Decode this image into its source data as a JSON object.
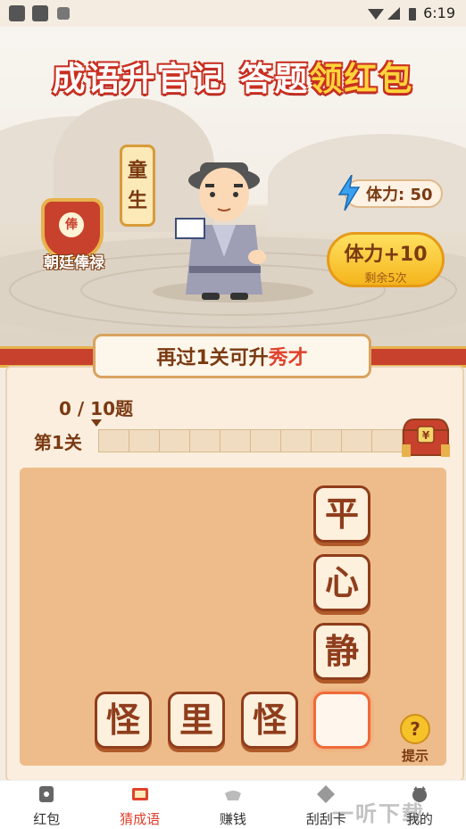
{
  "status_bar": {
    "time": "6:19"
  },
  "header": {
    "title_main": "成语升官记 答题",
    "title_highlight": "领红包"
  },
  "profile": {
    "rank": "童生",
    "salary_label": "朝廷俸禄",
    "salary_coin": "俸",
    "stamina_label": "体力: 50",
    "stamina_button": "体力+10",
    "stamina_remaining": "剩余5次"
  },
  "promotion": {
    "prefix": "再过1关可升",
    "rank_next": "秀才"
  },
  "progress": {
    "count": "0 / 10题",
    "level": "第1关",
    "segments": 10,
    "completed": 0
  },
  "board": {
    "column_tiles": [
      "平",
      "心",
      "静"
    ],
    "answer_tiles": [
      "怪",
      "里",
      "怪",
      ""
    ],
    "hint_label": "提示"
  },
  "tabs": [
    {
      "label": "红包",
      "icon": "wallet-icon",
      "active": false
    },
    {
      "label": "猜成语",
      "icon": "scroll-icon",
      "active": true
    },
    {
      "label": "赚钱",
      "icon": "ingot-icon",
      "active": false
    },
    {
      "label": "刮刮卡",
      "icon": "scratch-card-icon",
      "active": false
    },
    {
      "label": "我的",
      "icon": "profile-icon",
      "active": false
    }
  ],
  "watermark": "一听下载",
  "colors": {
    "accent": "#e0412d",
    "brown": "#7a3a12",
    "gold": "#f5b51c"
  }
}
